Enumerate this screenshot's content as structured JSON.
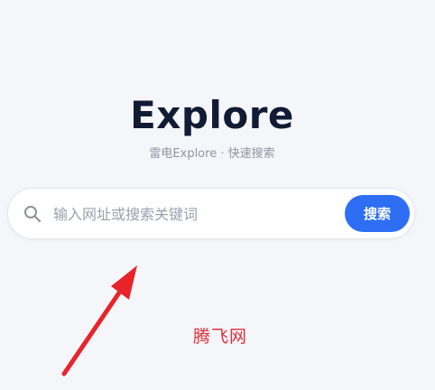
{
  "hero": {
    "title": "Explore",
    "subtitle": "雷电Explore · 快速搜索"
  },
  "search": {
    "placeholder": "输入网址或搜索关键词",
    "value": "",
    "button_label": "搜索",
    "icon": "search-icon"
  },
  "annotation": {
    "arrow_icon": "arrow-up-right-icon",
    "arrow_color": "#e8242b",
    "watermark_text": "腾飞网"
  },
  "colors": {
    "background": "#f5f6fa",
    "accent": "#2d6ef5",
    "title": "#111b33",
    "subtitle": "#8e95a3"
  }
}
